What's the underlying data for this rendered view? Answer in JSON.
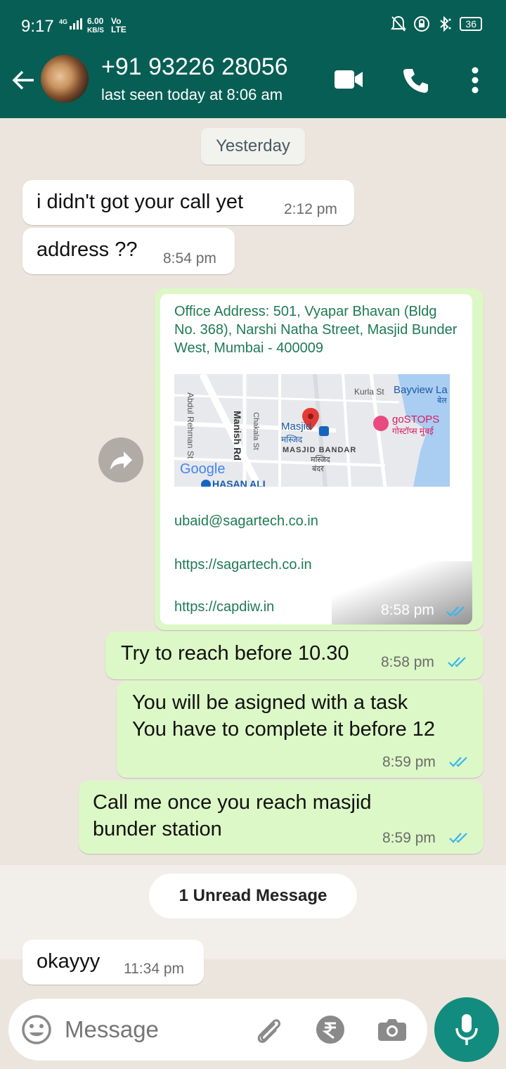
{
  "status_bar": {
    "time": "9:17",
    "network": "4G",
    "speed_value": "6.00",
    "speed_unit": "KB/S",
    "volte_top": "Vo",
    "volte_bottom": "LTE",
    "battery": "36"
  },
  "header": {
    "contact": "+91 93226 28056",
    "last_seen": "last seen today at 8:06 am"
  },
  "chat": {
    "date_chip": "Yesterday",
    "messages": [
      {
        "dir": "in",
        "text": "i didn't got your call yet",
        "time": "2:12 pm"
      },
      {
        "dir": "in",
        "text": "address ??",
        "time": "8:54 pm"
      },
      {
        "dir": "out",
        "time": "8:58 pm",
        "read": true,
        "card": {
          "address": "Office Address: 501, Vyapar Bhavan (Bldg No. 368), Narshi Natha Street, Masjid Bunder West, Mumbai - 400009",
          "email": "ubaid@sagartech.co.in",
          "link1": "https://sagartech.co.in",
          "link2": "https://capdiw.in",
          "map_labels": {
            "kurla": "Kurla St",
            "bayview": "Bayview La",
            "bayview_hi": "बेल",
            "abdul": "Abdul Rehman St",
            "manish": "Manish Rd",
            "chakala": "Chakala St",
            "masjid": "Masjid",
            "masjid_hi": "मस्जिद",
            "gostops": "goSTOPS",
            "gostops_hi": "गोस्टॉप्स मुंबई",
            "masjid_bandar": "MASJID BANDAR",
            "masjid_bandar_hi1": "मस्जिद",
            "masjid_bandar_hi2": "बंदर",
            "google": "Google",
            "hasan": "HASAN ALI"
          }
        }
      },
      {
        "dir": "out",
        "text": "Try to reach before 10.30",
        "time": "8:58 pm",
        "read": true
      },
      {
        "dir": "out",
        "text_line1": "You will be asigned with a task",
        "text_line2": "You have to complete it before 12",
        "time": "8:59 pm",
        "read": true
      },
      {
        "dir": "out",
        "text_line1": "Call me  once you reach masjid",
        "text_line2": "bunder station",
        "time": "8:59 pm",
        "read": true
      },
      {
        "dir": "in",
        "text": "okayyy",
        "time": "11:34 pm"
      }
    ],
    "unread_label": "1 Unread Message"
  },
  "input": {
    "placeholder": "Message"
  },
  "colors": {
    "header": "#075e54",
    "outgoing": "#dcf8c6",
    "incoming": "#ffffff",
    "read_ticks": "#34b7f1",
    "link": "#1f7a55",
    "mic": "#128c7e"
  },
  "icons": [
    "back-arrow-icon",
    "video-call-icon",
    "voice-call-icon",
    "more-options-icon",
    "forward-icon",
    "emoji-icon",
    "attach-icon",
    "rupee-payment-icon",
    "camera-icon",
    "mic-icon"
  ]
}
